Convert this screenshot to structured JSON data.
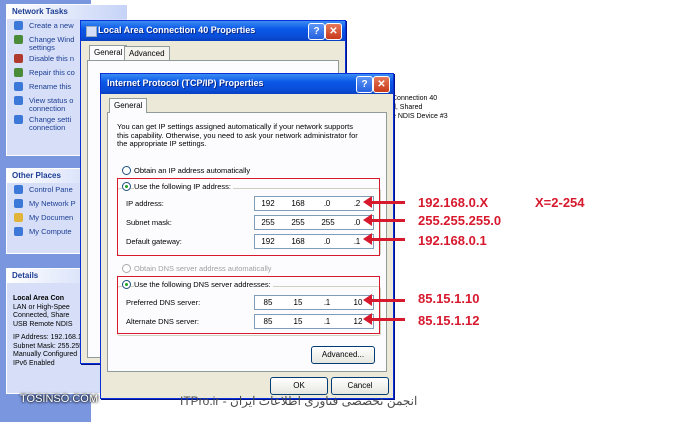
{
  "taskpane": {
    "network_tasks": {
      "title": "Network Tasks",
      "items": [
        {
          "label": "Create a new",
          "color": "#3c78d8"
        },
        {
          "label": "Change Wind\nsettings",
          "color": "#4a8c3a"
        },
        {
          "label": "Disable this n",
          "color": "#b03a2e"
        },
        {
          "label": "Repair this co",
          "color": "#4a8c3a"
        },
        {
          "label": "Rename this",
          "color": "#3c78d8"
        },
        {
          "label": "View status o\nconnection",
          "color": "#3c78d8"
        },
        {
          "label": "Change setti\nconnection",
          "color": "#3c78d8"
        }
      ]
    },
    "other_places": {
      "title": "Other Places",
      "items": [
        {
          "label": "Control Pane",
          "color": "#3c78d8"
        },
        {
          "label": "My Network P",
          "color": "#3c78d8"
        },
        {
          "label": "My Documen",
          "color": "#e0b43a"
        },
        {
          "label": "My Compute",
          "color": "#3c78d8"
        }
      ]
    },
    "details": {
      "title": "Details",
      "name": "Local Area Con",
      "lines": [
        "LAN or High-Spee",
        "Connected, Share",
        "USB Remote NDIS",
        "",
        "IP Address: 192.168.1",
        "Subnet Mask: 255.255.",
        "Manually Configured",
        "IPv6 Enabled"
      ]
    }
  },
  "back_window": {
    "title": "Local Area Connection 40 Properties",
    "tabs": [
      "General",
      "Advanced"
    ],
    "side_text": [
      "Connection 40",
      "d, Shared",
      "e NDIS Device #3"
    ]
  },
  "tcpip_window": {
    "title": "Internet Protocol (TCP/IP) Properties",
    "tab": "General",
    "intro": "You can get IP settings assigned automatically if your network supports\nthis capability. Otherwise, you need to ask your network administrator for\nthe appropriate IP settings.",
    "radio_auto_ip": "Obtain an IP address automatically",
    "radio_use_ip": "Use the following IP address:",
    "fields": [
      {
        "label": "IP address:",
        "octets": [
          "192",
          "168",
          "0",
          "2"
        ]
      },
      {
        "label": "Subnet mask:",
        "octets": [
          "255",
          "255",
          "255",
          "0"
        ]
      },
      {
        "label": "Default gateway:",
        "octets": [
          "192",
          "168",
          "0",
          "1"
        ]
      }
    ],
    "radio_auto_dns": "Obtain DNS server address automatically",
    "radio_use_dns": "Use the following DNS server addresses:",
    "dns_fields": [
      {
        "label": "Preferred DNS server:",
        "octets": [
          "85",
          "15",
          "1",
          "10"
        ]
      },
      {
        "label": "Alternate DNS server:",
        "octets": [
          "85",
          "15",
          "1",
          "12"
        ]
      }
    ],
    "advanced_button": "Advanced...",
    "ok_button": "OK",
    "cancel_button": "Cancel"
  },
  "annotations": {
    "ip": "192.168.0.X",
    "x_range": "X=2-254",
    "mask": "255.255.255.0",
    "gateway": "192.168.0.1",
    "dns1": "85.15.1.10",
    "dns2": "85.15.1.12",
    "color": "#d7192e"
  },
  "footer": {
    "left": "TOSINSO.COM",
    "right": "ITPro.ir - انجمن تخصصی فناوری اطلاعات ایران"
  }
}
